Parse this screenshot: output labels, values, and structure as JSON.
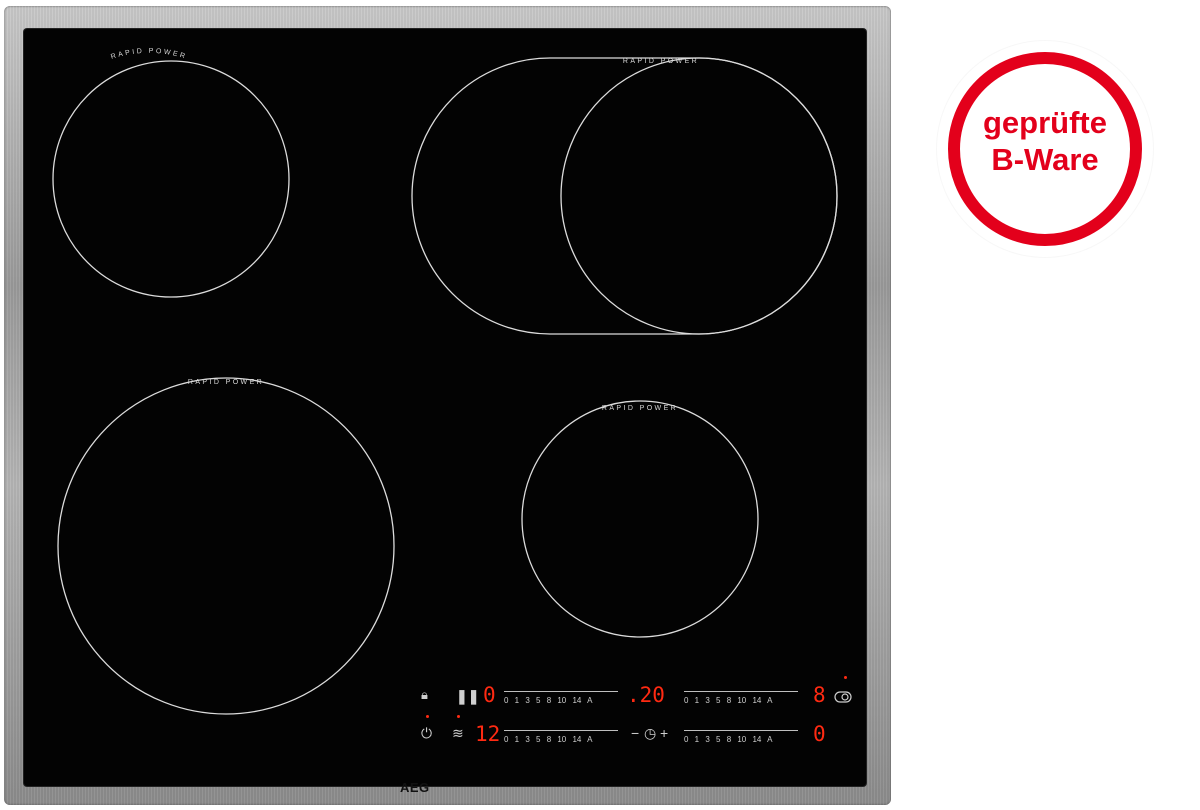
{
  "image": {
    "subject": "ceramic glass cooktop with stainless frame",
    "brand_logo": "AEG",
    "badge": {
      "line1": "geprüfte",
      "line2": "B-Ware",
      "color": "#e3001b"
    },
    "zones": [
      {
        "label": "RAPID POWER"
      },
      {
        "label": "RAPID POWER"
      },
      {
        "label": "RAPID POWER"
      },
      {
        "label": "RAPID POWER"
      }
    ],
    "controls": {
      "scale_text": "0 1 3 5  8 10   14 A",
      "row1": {
        "lock_icon": "lock-icon",
        "pause_icon": "pause-icon",
        "display_left": "0",
        "display_center": ".20",
        "display_right": "8",
        "bridge_icon": "bridge-icon"
      },
      "row2": {
        "power_icon": "power-icon",
        "warm_icon": "keep-warm-icon",
        "display_left": "12",
        "timer_minus": "−",
        "timer_icon": "timer-icon",
        "timer_plus": "+",
        "display_right": "0"
      }
    },
    "colors": {
      "glass": "#030303",
      "led": "#ff2a12",
      "frame": "#a8a8a8"
    }
  }
}
